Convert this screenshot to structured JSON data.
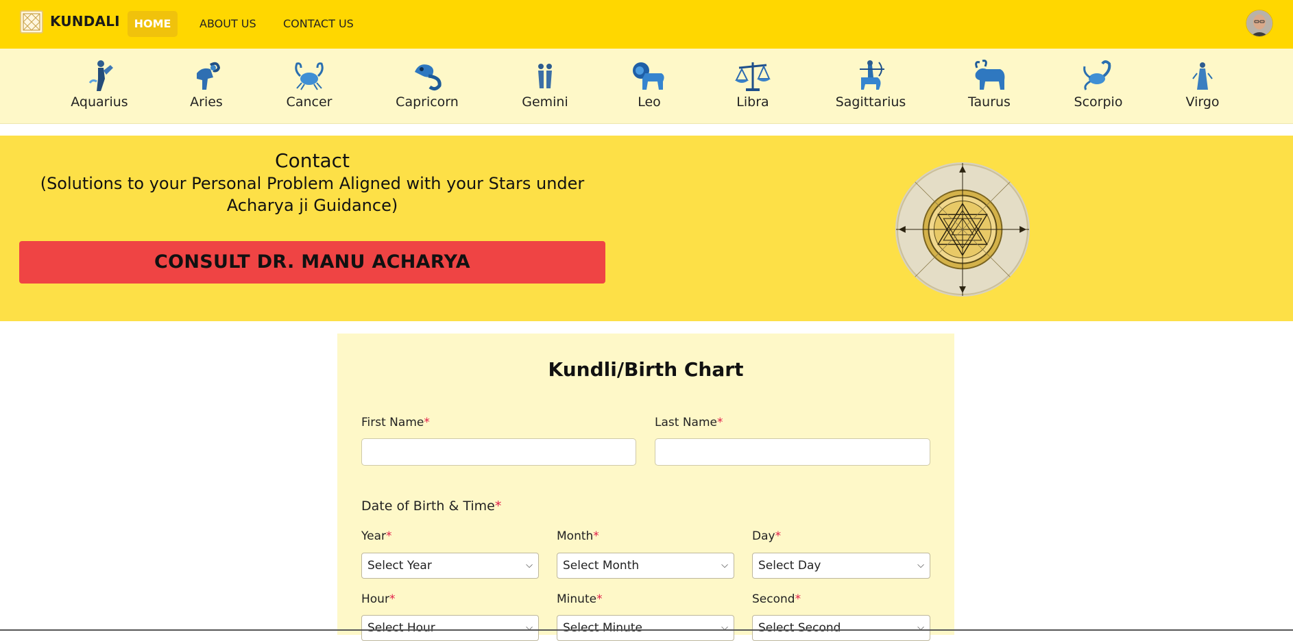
{
  "navbar": {
    "brand": "KUNDALI",
    "links": {
      "home": "HOME",
      "about": "ABOUT US",
      "contact": "CONTACT US"
    },
    "active": "HOME",
    "colors": {
      "background": "#ffd700",
      "active_bg": "#f0c20c"
    }
  },
  "zodiac": [
    {
      "label": "Aquarius",
      "icon": "aquarius-icon"
    },
    {
      "label": "Aries",
      "icon": "aries-icon"
    },
    {
      "label": "Cancer",
      "icon": "cancer-icon"
    },
    {
      "label": "Capricorn",
      "icon": "capricorn-icon"
    },
    {
      "label": "Gemini",
      "icon": "gemini-icon"
    },
    {
      "label": "Leo",
      "icon": "leo-icon"
    },
    {
      "label": "Libra",
      "icon": "libra-icon"
    },
    {
      "label": "Sagittarius",
      "icon": "sagittarius-icon"
    },
    {
      "label": "Taurus",
      "icon": "taurus-icon"
    },
    {
      "label": "Scorpio",
      "icon": "scorpio-icon"
    },
    {
      "label": "Virgo",
      "icon": "virgo-icon"
    }
  ],
  "banner": {
    "title": "Contact",
    "subtitle": "(Solutions to your Personal Problem Aligned with your Stars under Acharya ji Guidance)",
    "cta": "CONSULT DR. MANU ACHARYA",
    "colors": {
      "background": "#fde047",
      "cta": "#ef4444"
    },
    "image": "sri-yantra-icon"
  },
  "form": {
    "title": "Kundli/Birth Chart",
    "first_name_label": "First Name",
    "last_name_label": "Last Name",
    "dob_section": "Date of Birth & Time",
    "required_mark": "*",
    "year_label": "Year",
    "month_label": "Month",
    "day_label": "Day",
    "hour_label": "Hour",
    "minute_label": "Minute",
    "second_label": "Second",
    "year_value": "Select Year",
    "month_value": "Select Month",
    "day_value": "Select Day",
    "hour_value": "Select Hour",
    "minute_value": "Select Minute",
    "second_value": "Select Second",
    "colors": {
      "card": "#fef8c8",
      "required": "#e11d48"
    }
  }
}
